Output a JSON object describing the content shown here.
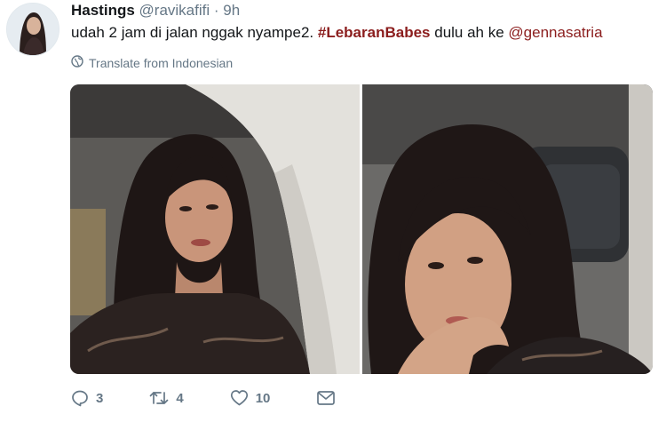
{
  "tweet": {
    "author_name": "Hastings",
    "handle": "@ravikafifi",
    "separator": "·",
    "time": "9h",
    "text_before": "udah 2 jam di jalan nggak nyampe2.",
    "hashtag": "#LebaranBabes",
    "text_middle": "dulu ah ke",
    "mention": "@gennasatria",
    "translate_label": "Translate from Indonesian"
  },
  "actions": {
    "reply_count": "3",
    "retweet_count": "4",
    "like_count": "10"
  },
  "icons": {
    "translate": "globe-icon",
    "reply": "reply-icon",
    "retweet": "retweet-icon",
    "like": "heart-icon",
    "message": "envelope-icon"
  },
  "colors": {
    "link": "#8b1d1d",
    "muted": "#657786"
  }
}
